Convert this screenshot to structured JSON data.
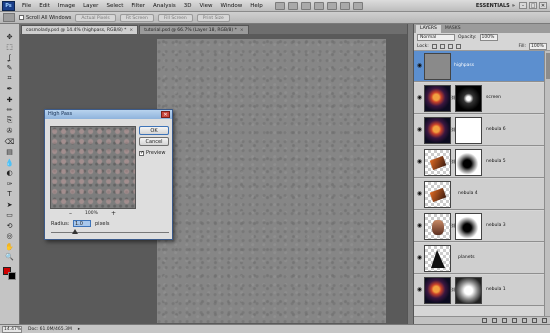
{
  "app": {
    "logo_text": "Ps",
    "menu": [
      "File",
      "Edit",
      "Image",
      "Layer",
      "Select",
      "Filter",
      "Analysis",
      "3D",
      "View",
      "Window",
      "Help"
    ],
    "workspace": "ESSENTIALS",
    "workspace_icon": "chevron-double-right-icon",
    "window_buttons": [
      "–",
      "□",
      "✕"
    ]
  },
  "options_bar": {
    "scroll_all_label": "Scroll All Windows",
    "buttons": [
      "Actual Pixels",
      "Fit Screen",
      "Fill Screen",
      "Print Size"
    ]
  },
  "tabs": [
    {
      "label": "cosmolady.psd @ 14.4% (highpass, RGB/8) *",
      "close": "×",
      "active": true
    },
    {
      "label": "tutorial.psd @ 66.7% (Layer 18, RGB/8) *",
      "close": "×",
      "active": false
    }
  ],
  "tools": [
    "move-icon",
    "marquee-icon",
    "lasso-icon",
    "quick-select-icon",
    "crop-icon",
    "eyedropper-icon",
    "healing-icon",
    "brush-icon",
    "clone-icon",
    "history-brush-icon",
    "eraser-icon",
    "gradient-icon",
    "blur-icon",
    "dodge-icon",
    "pen-icon",
    "type-icon",
    "path-select-icon",
    "shape-icon",
    "3d-rotate-icon",
    "3d-orbit-icon",
    "hand-icon",
    "zoom-icon"
  ],
  "tool_glyphs": [
    "✥",
    "⬚",
    "ʆ",
    "✎",
    "⌗",
    "✒",
    "✚",
    "✏",
    "⎘",
    "✇",
    "⌫",
    "▤",
    "💧",
    "◐",
    "✑",
    "T",
    "➤",
    "▭",
    "⟲",
    "◎",
    "✋",
    "🔍"
  ],
  "colors": {
    "foreground": "#d00000",
    "background": "#000000",
    "selection": "#5c8fcf"
  },
  "dialog": {
    "title": "High Pass",
    "close": "✕",
    "ok_label": "OK",
    "cancel_label": "Cancel",
    "preview_label": "Preview",
    "preview_checked": true,
    "zoom": "100%",
    "zoom_minus": "–",
    "zoom_plus": "+",
    "radius_label": "Radius:",
    "radius_value": "1.0",
    "radius_unit": "pixels",
    "radius_slider_fraction": 0.2
  },
  "layers_panel": {
    "tabs": [
      "LAYERS",
      "MASKS"
    ],
    "blend_mode": "Normal",
    "opacity_label": "Opacity:",
    "opacity_value": "100%",
    "lock_label": "Lock:",
    "fill_label": "Fill:",
    "fill_value": "100%",
    "layers": [
      {
        "name": "highpass",
        "selected": true,
        "thumb": "gray",
        "mask": "none"
      },
      {
        "name": "screen",
        "selected": false,
        "thumb": "nebula",
        "mask": "dark-cloud"
      },
      {
        "name": "nebula 6",
        "selected": false,
        "thumb": "nebula",
        "mask": "white"
      },
      {
        "name": "nebula 5",
        "selected": false,
        "thumb": "fragment",
        "mask": "blob"
      },
      {
        "name": "nebula 4",
        "selected": false,
        "thumb": "fragment",
        "mask": "none"
      },
      {
        "name": "nebula 3",
        "selected": false,
        "thumb": "face",
        "mask": "blob"
      },
      {
        "name": "planets",
        "selected": false,
        "thumb": "shard",
        "mask": "none"
      },
      {
        "name": "nebula 1",
        "selected": false,
        "thumb": "nebula",
        "mask": "soft"
      }
    ]
  },
  "status": {
    "zoom": "14.47%",
    "doc": "Doc: 61.0M/465.3M",
    "arrow": "▸"
  }
}
